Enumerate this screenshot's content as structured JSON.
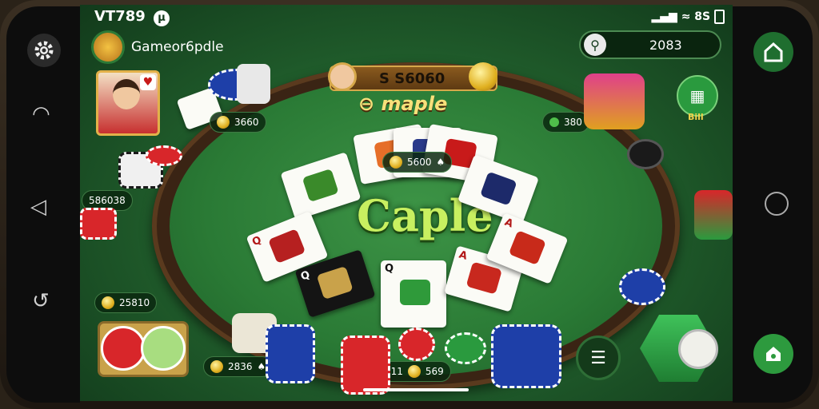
{
  "status_bar": {
    "brand": "VT789",
    "badge": "µ",
    "signal_text": "8S"
  },
  "profile": {
    "name": "Gameor6pdle"
  },
  "search": {
    "value": "2083"
  },
  "pot": {
    "amount": "S S6060",
    "label": "⊖ maple"
  },
  "center_title": "Caple",
  "bets": {
    "player_left_top": "3660",
    "player_right_top": "380",
    "player_left_mid": "586038",
    "center_stack": "5600",
    "player_left_bottom": "25810",
    "bottom_left": "2836",
    "bottom_center_a": "511",
    "bottom_center_b": "569"
  },
  "right_menu": {
    "shop_label": "Bill"
  },
  "colors": {
    "felt": "#2a7a35",
    "accent_green": "#2e9a3e",
    "gold": "#e0b020",
    "chip_red": "#d8262a",
    "chip_blue": "#1e3fa8"
  },
  "icons": [
    "gear-icon",
    "back-icon",
    "home-icon",
    "undo-icon",
    "search-icon",
    "home-button-icon",
    "shop-icon",
    "menu-icon",
    "settings-icon"
  ]
}
